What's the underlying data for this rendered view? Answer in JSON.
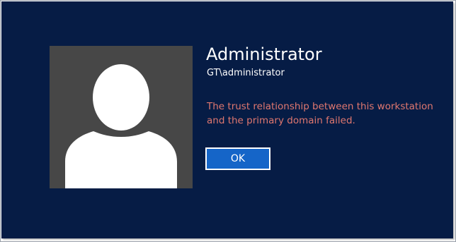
{
  "user": {
    "name": "Administrator",
    "domain_account": "GT\\administrator"
  },
  "message": {
    "lines": [
      "The trust relationship between this workstation",
      "and the primary domain failed."
    ]
  },
  "buttons": {
    "ok_label": "OK"
  },
  "icons": {
    "avatar": "user-silhouette-icon"
  },
  "colors": {
    "background": "#061c45",
    "avatar_tile": "#474747",
    "error_text": "#e0776f",
    "button": "#1565c8",
    "text": "#ffffff"
  }
}
